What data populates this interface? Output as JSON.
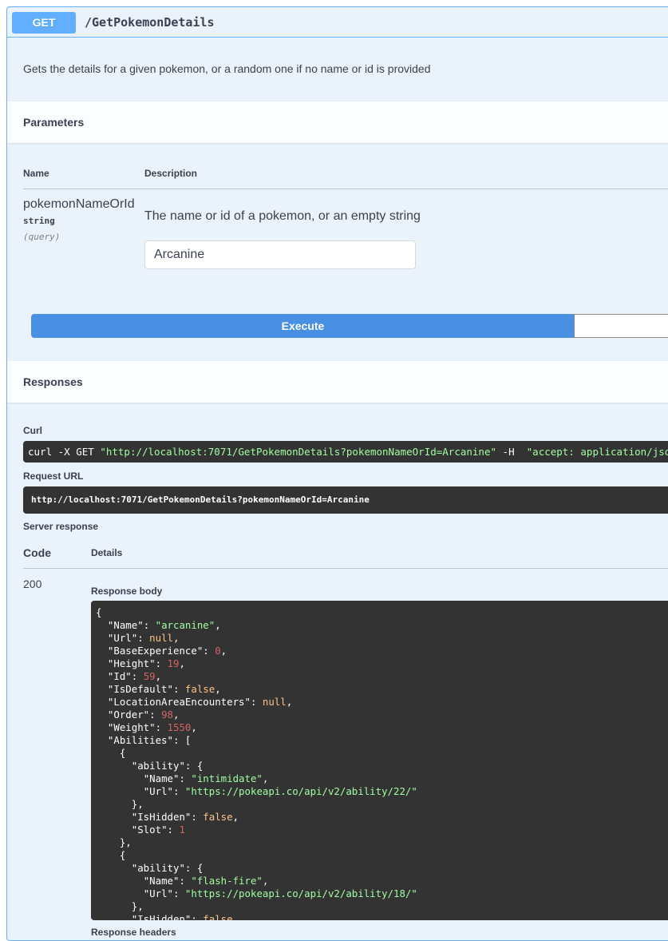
{
  "operation": {
    "method": "GET",
    "path": "/GetPokemonDetails",
    "description": "Gets the details for a given pokemon, or a random one if no name or id is provided"
  },
  "parameters": {
    "title": "Parameters",
    "col_name": "Name",
    "col_description": "Description",
    "items": [
      {
        "name": "pokemonNameOrId",
        "type": "string",
        "in": "(query)",
        "description": "The name or id of a pokemon, or an empty string",
        "value": "Arcanine"
      }
    ],
    "execute_label": "Execute"
  },
  "responses": {
    "title": "Responses",
    "curl_label": "Curl",
    "curl": {
      "prefix": "curl -X GET ",
      "url": "\"http://localhost:7071/GetPokemonDetails?pokemonNameOrId=Arcanine\"",
      "flag": " -H  ",
      "header": "\"accept: application/json\""
    },
    "request_url_label": "Request URL",
    "request_url": "http://localhost:7071/GetPokemonDetails?pokemonNameOrId=Arcanine",
    "server_response_label": "Server response",
    "col_code": "Code",
    "col_details": "Details",
    "code": "200",
    "body_label": "Response body",
    "headers_label": "Response headers",
    "body_lines": [
      [
        {
          "t": "p",
          "v": "{"
        }
      ],
      [
        {
          "t": "p",
          "v": "  "
        },
        {
          "t": "k",
          "v": "\"Name\""
        },
        {
          "t": "p",
          "v": ": "
        },
        {
          "t": "s",
          "v": "\"arcanine\""
        },
        {
          "t": "p",
          "v": ","
        }
      ],
      [
        {
          "t": "p",
          "v": "  "
        },
        {
          "t": "k",
          "v": "\"Url\""
        },
        {
          "t": "p",
          "v": ": "
        },
        {
          "t": "lit",
          "v": "null"
        },
        {
          "t": "p",
          "v": ","
        }
      ],
      [
        {
          "t": "p",
          "v": "  "
        },
        {
          "t": "k",
          "v": "\"BaseExperience\""
        },
        {
          "t": "p",
          "v": ": "
        },
        {
          "t": "n",
          "v": "0"
        },
        {
          "t": "p",
          "v": ","
        }
      ],
      [
        {
          "t": "p",
          "v": "  "
        },
        {
          "t": "k",
          "v": "\"Height\""
        },
        {
          "t": "p",
          "v": ": "
        },
        {
          "t": "n",
          "v": "19"
        },
        {
          "t": "p",
          "v": ","
        }
      ],
      [
        {
          "t": "p",
          "v": "  "
        },
        {
          "t": "k",
          "v": "\"Id\""
        },
        {
          "t": "p",
          "v": ": "
        },
        {
          "t": "n",
          "v": "59"
        },
        {
          "t": "p",
          "v": ","
        }
      ],
      [
        {
          "t": "p",
          "v": "  "
        },
        {
          "t": "k",
          "v": "\"IsDefault\""
        },
        {
          "t": "p",
          "v": ": "
        },
        {
          "t": "lit",
          "v": "false"
        },
        {
          "t": "p",
          "v": ","
        }
      ],
      [
        {
          "t": "p",
          "v": "  "
        },
        {
          "t": "k",
          "v": "\"LocationAreaEncounters\""
        },
        {
          "t": "p",
          "v": ": "
        },
        {
          "t": "lit",
          "v": "null"
        },
        {
          "t": "p",
          "v": ","
        }
      ],
      [
        {
          "t": "p",
          "v": "  "
        },
        {
          "t": "k",
          "v": "\"Order\""
        },
        {
          "t": "p",
          "v": ": "
        },
        {
          "t": "n",
          "v": "98"
        },
        {
          "t": "p",
          "v": ","
        }
      ],
      [
        {
          "t": "p",
          "v": "  "
        },
        {
          "t": "k",
          "v": "\"Weight\""
        },
        {
          "t": "p",
          "v": ": "
        },
        {
          "t": "n",
          "v": "1550"
        },
        {
          "t": "p",
          "v": ","
        }
      ],
      [
        {
          "t": "p",
          "v": "  "
        },
        {
          "t": "k",
          "v": "\"Abilities\""
        },
        {
          "t": "p",
          "v": ": ["
        }
      ],
      [
        {
          "t": "p",
          "v": "    {"
        }
      ],
      [
        {
          "t": "p",
          "v": "      "
        },
        {
          "t": "k",
          "v": "\"ability\""
        },
        {
          "t": "p",
          "v": ": {"
        }
      ],
      [
        {
          "t": "p",
          "v": "        "
        },
        {
          "t": "k",
          "v": "\"Name\""
        },
        {
          "t": "p",
          "v": ": "
        },
        {
          "t": "s",
          "v": "\"intimidate\""
        },
        {
          "t": "p",
          "v": ","
        }
      ],
      [
        {
          "t": "p",
          "v": "        "
        },
        {
          "t": "k",
          "v": "\"Url\""
        },
        {
          "t": "p",
          "v": ": "
        },
        {
          "t": "s",
          "v": "\"https://pokeapi.co/api/v2/ability/22/\""
        }
      ],
      [
        {
          "t": "p",
          "v": "      },"
        }
      ],
      [
        {
          "t": "p",
          "v": "      "
        },
        {
          "t": "k",
          "v": "\"IsHidden\""
        },
        {
          "t": "p",
          "v": ": "
        },
        {
          "t": "lit",
          "v": "false"
        },
        {
          "t": "p",
          "v": ","
        }
      ],
      [
        {
          "t": "p",
          "v": "      "
        },
        {
          "t": "k",
          "v": "\"Slot\""
        },
        {
          "t": "p",
          "v": ": "
        },
        {
          "t": "n",
          "v": "1"
        }
      ],
      [
        {
          "t": "p",
          "v": "    },"
        }
      ],
      [
        {
          "t": "p",
          "v": "    {"
        }
      ],
      [
        {
          "t": "p",
          "v": "      "
        },
        {
          "t": "k",
          "v": "\"ability\""
        },
        {
          "t": "p",
          "v": ": {"
        }
      ],
      [
        {
          "t": "p",
          "v": "        "
        },
        {
          "t": "k",
          "v": "\"Name\""
        },
        {
          "t": "p",
          "v": ": "
        },
        {
          "t": "s",
          "v": "\"flash-fire\""
        },
        {
          "t": "p",
          "v": ","
        }
      ],
      [
        {
          "t": "p",
          "v": "        "
        },
        {
          "t": "k",
          "v": "\"Url\""
        },
        {
          "t": "p",
          "v": ": "
        },
        {
          "t": "s",
          "v": "\"https://pokeapi.co/api/v2/ability/18/\""
        }
      ],
      [
        {
          "t": "p",
          "v": "      },"
        }
      ],
      [
        {
          "t": "p",
          "v": "      "
        },
        {
          "t": "k",
          "v": "\"IsHidden\""
        },
        {
          "t": "p",
          "v": ": "
        },
        {
          "t": "lit",
          "v": "false"
        }
      ]
    ]
  },
  "colors": {
    "get_accent": "#61affe",
    "execute_blue": "#4990e2",
    "code_bg": "#333333",
    "json_string": "#a2fca2",
    "json_number": "#d36363",
    "json_literal": "#fcc28c"
  }
}
